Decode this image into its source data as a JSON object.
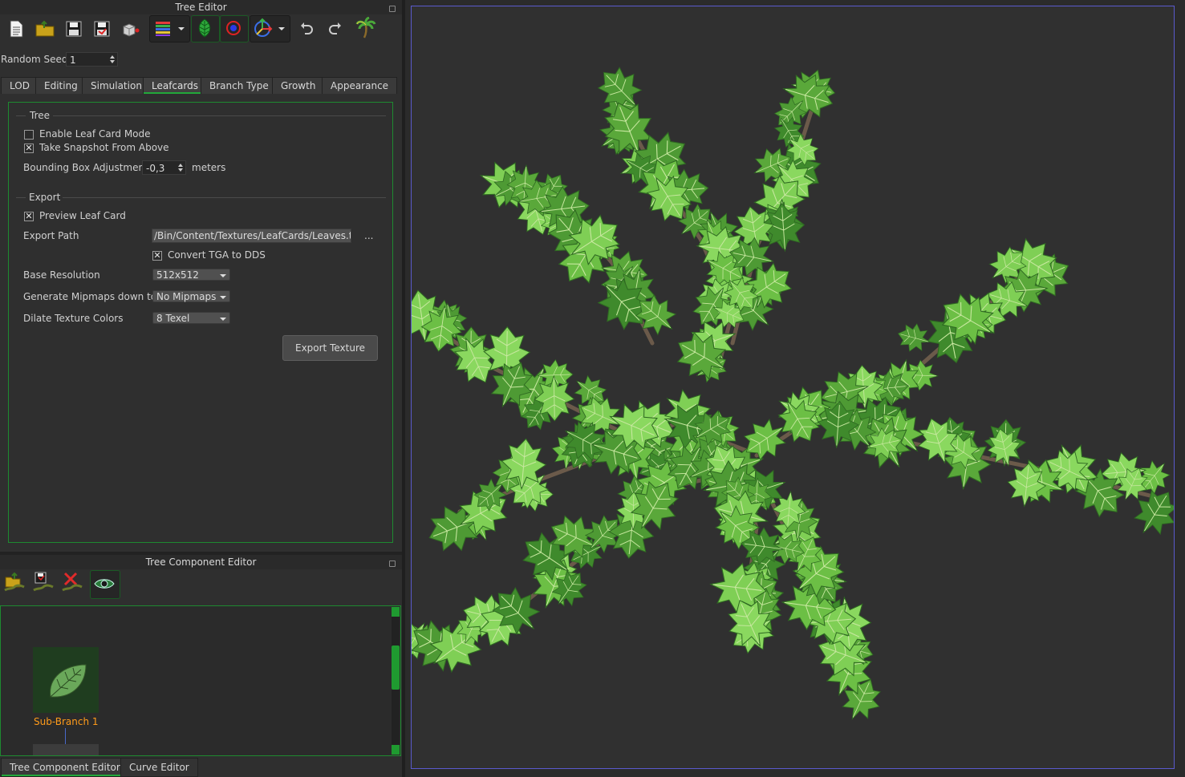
{
  "tree_editor": {
    "title": "Tree Editor",
    "random_seed_label": "Random Seed",
    "random_seed_value": "1",
    "tabs": [
      {
        "label": "LOD",
        "active": false
      },
      {
        "label": "Editing",
        "active": false
      },
      {
        "label": "Simulation",
        "active": false
      },
      {
        "label": "Leafcards",
        "active": true
      },
      {
        "label": "Branch Type",
        "active": false
      },
      {
        "label": "Growth",
        "active": false
      },
      {
        "label": "Appearance",
        "active": false
      }
    ],
    "leafcards": {
      "tree_section_label": "Tree",
      "enable_leaf_card_mode": {
        "label": "Enable Leaf Card Mode",
        "checked": false,
        "mark": ""
      },
      "take_snapshot_from_above": {
        "label": "Take Snapshot From Above",
        "checked": true,
        "mark": "✕"
      },
      "bounding_box_label": "Bounding Box Adjustment",
      "bounding_box_value": "-0,3",
      "bounding_box_unit": "meters",
      "export_section_label": "Export",
      "preview_leaf_card": {
        "label": "Preview Leaf Card",
        "checked": true,
        "mark": "✕"
      },
      "export_path_label": "Export Path",
      "export_path_value": "/Bin/Content/Textures/LeafCards/Leaves.tga",
      "browse_label": "...",
      "convert_tga": {
        "label": "Convert TGA to DDS",
        "checked": true,
        "mark": "✕"
      },
      "base_resolution_label": "Base Resolution",
      "base_resolution_value": "512x512",
      "mipmaps_label": "Generate Mipmaps down to",
      "mipmaps_value": "No Mipmaps",
      "dilate_label": "Dilate Texture Colors",
      "dilate_value": "8 Texel",
      "export_button": "Export Texture"
    }
  },
  "component_editor": {
    "title": "Tree Component Editor",
    "node_label": "Sub-Branch 1",
    "bottom_tabs": [
      {
        "label": "Tree Component Editor",
        "active": true
      },
      {
        "label": "Curve Editor",
        "active": false
      }
    ]
  },
  "colors": {
    "accent_green": "#22a83a",
    "node_label_orange": "#ff9b1a",
    "viewport_border": "#5a5acd"
  },
  "icons": [
    "new-file-icon",
    "open-folder-icon",
    "save-icon",
    "save-as-icon",
    "cube-icon",
    "color-bars-icon",
    "leaf-icon",
    "target-icon",
    "gizmo-icon",
    "undo-icon",
    "redo-icon",
    "palm-tree-icon",
    "load-component-icon",
    "save-component-icon",
    "delete-component-icon",
    "eye-icon"
  ]
}
